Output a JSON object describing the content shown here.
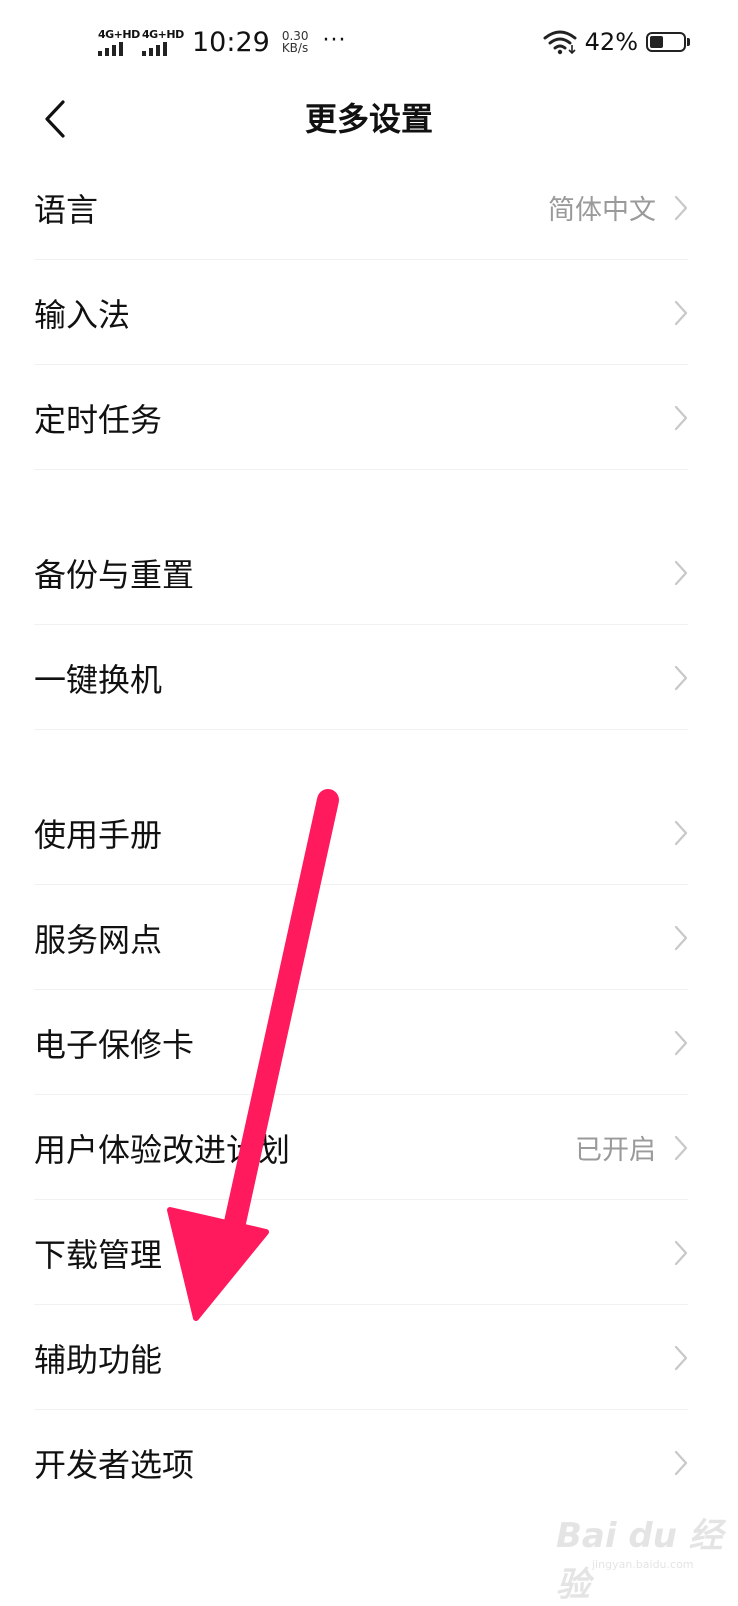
{
  "status_bar": {
    "sim1_label": "4G+HD",
    "sim2_label": "4G+HD",
    "time": "10:29",
    "net_speed_value": "0.30",
    "net_speed_unit": "KB/s",
    "more_indicator": "···",
    "battery_percent": "42%",
    "battery_level": 0.42
  },
  "header": {
    "title": "更多设置",
    "back_icon": "chevron-left-icon"
  },
  "settings": {
    "language": {
      "label": "语言",
      "value": "简体中文"
    },
    "input_method": {
      "label": "输入法"
    },
    "scheduled_tasks": {
      "label": "定时任务"
    },
    "backup_reset": {
      "label": "备份与重置"
    },
    "phone_clone": {
      "label": "一键换机"
    },
    "user_manual": {
      "label": "使用手册"
    },
    "service_outlets": {
      "label": "服务网点"
    },
    "warranty_card": {
      "label": "电子保修卡"
    },
    "ux_program": {
      "label": "用户体验改进计划",
      "value": "已开启"
    },
    "download_manager": {
      "label": "下载管理"
    },
    "accessibility": {
      "label": "辅助功能"
    },
    "developer_options": {
      "label": "开发者选项"
    }
  },
  "watermark": {
    "text": "Bai du 经验",
    "sub": "jingyan.baidu.com"
  },
  "colors": {
    "arrow": "#ff1a5e",
    "secondary_text": "#9a9a9a",
    "chevron": "#c8c8c8"
  }
}
